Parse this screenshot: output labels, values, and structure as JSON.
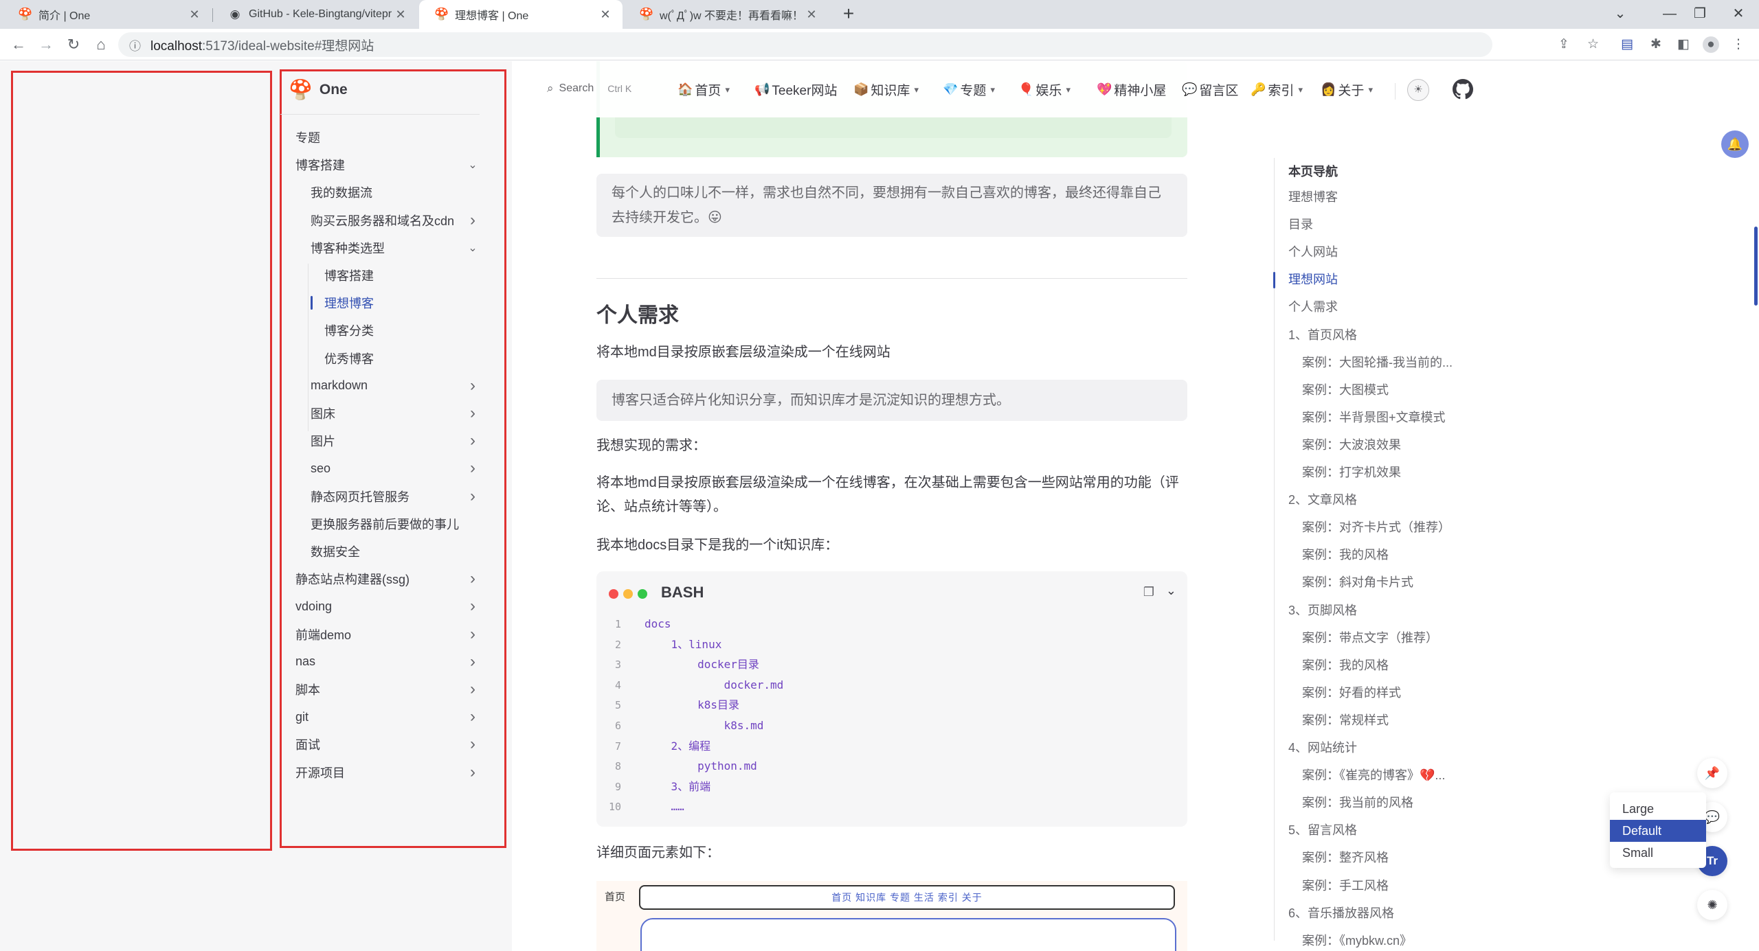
{
  "browser": {
    "tabs": [
      {
        "title": "简介 | One",
        "favicon": "vitepress-logo"
      },
      {
        "title": "GitHub - Kele-Bingtang/vitepr",
        "favicon": "github-icon"
      },
      {
        "title": "理想博客 | One",
        "favicon": "vitepress-logo"
      },
      {
        "title": "w(ﾟДﾟ)w 不要走！再看看嘛！",
        "favicon": "vitepress-logo"
      }
    ],
    "url_host": "localhost",
    "url_rest": ":5173/ideal-website#理想网站"
  },
  "sidebar": {
    "brand": "One",
    "items": [
      {
        "label": "专题",
        "level": 0,
        "chevron": ""
      },
      {
        "label": "博客搭建",
        "level": 0,
        "chevron": "down"
      },
      {
        "label": "我的数据流",
        "level": 1,
        "chevron": ""
      },
      {
        "label": "购买云服务器和域名及cdn",
        "level": 1,
        "chevron": "right"
      },
      {
        "label": "博客种类选型",
        "level": 1,
        "chevron": "down"
      },
      {
        "label": "博客搭建",
        "level": 2,
        "chevron": ""
      },
      {
        "label": "理想博客",
        "level": 2,
        "chevron": "",
        "active": true
      },
      {
        "label": "博客分类",
        "level": 2,
        "chevron": ""
      },
      {
        "label": "优秀博客",
        "level": 2,
        "chevron": ""
      },
      {
        "label": "markdown",
        "level": 1,
        "chevron": "right"
      },
      {
        "label": "图床",
        "level": 1,
        "chevron": "right"
      },
      {
        "label": "图片",
        "level": 1,
        "chevron": "right"
      },
      {
        "label": "seo",
        "level": 1,
        "chevron": "right"
      },
      {
        "label": "静态网页托管服务",
        "level": 1,
        "chevron": "right"
      },
      {
        "label": "更换服务器前后要做的事儿",
        "level": 1,
        "chevron": ""
      },
      {
        "label": "数据安全",
        "level": 1,
        "chevron": ""
      },
      {
        "label": "静态站点构建器(ssg)",
        "level": 0,
        "chevron": "right"
      },
      {
        "label": "vdoing",
        "level": 0,
        "chevron": "right"
      },
      {
        "label": "前端demo",
        "level": 0,
        "chevron": "right"
      },
      {
        "label": "nas",
        "level": 0,
        "chevron": "right"
      },
      {
        "label": "脚本",
        "level": 0,
        "chevron": "right"
      },
      {
        "label": "git",
        "level": 0,
        "chevron": "right"
      },
      {
        "label": "面试",
        "level": 0,
        "chevron": "right"
      },
      {
        "label": "开源项目",
        "level": 0,
        "chevron": "right"
      }
    ]
  },
  "topnav": {
    "search_label": "Search",
    "search_kbd": "Ctrl K",
    "items": [
      {
        "label": "首页",
        "icon": "🏠",
        "dropdown": true
      },
      {
        "label": "Teeker网站",
        "icon": "📢",
        "dropdown": false
      },
      {
        "label": "知识库",
        "icon": "📦",
        "dropdown": true
      },
      {
        "label": "专题",
        "icon": "💎",
        "dropdown": true
      },
      {
        "label": "娱乐",
        "icon": "🎈",
        "dropdown": true
      },
      {
        "label": "精神小屋",
        "icon": "💖",
        "dropdown": false
      },
      {
        "label": "留言区",
        "icon": "💬",
        "dropdown": false
      },
      {
        "label": "索引",
        "icon": "🔑",
        "dropdown": true
      },
      {
        "label": "关于",
        "icon": "👩",
        "dropdown": true
      }
    ]
  },
  "content": {
    "quote1_line1": "每个人的口味儿不一样，需求也自然不同，要想拥有一款自己喜欢的博客，最终还得靠自己",
    "quote1_line2": "去持续开发它。😛",
    "h2": "个人需求",
    "p1": "将本地md目录按原嵌套层级渲染成一个在线网站",
    "quote2": "博客只适合碎片化知识分享，而知识库才是沉淀知识的理想方式。",
    "p2": "我想实现的需求：",
    "p3_line1": "将本地md目录按原嵌套层级渲染成一个在线博客，在次基础上需要包含一些网站常用的功能（评",
    "p3_line2": "论、站点统计等等）。",
    "p4": "我本地docs目录下是我的一个it知识库：",
    "code_lang": "BASH",
    "code_lines": [
      "docs",
      "    1、linux",
      "        docker目录",
      "            docker.md",
      "        k8s目录",
      "            k8s.md",
      "    2、编程",
      "        python.md",
      "    3、前端",
      "    ……"
    ],
    "p5": "详细页面元素如下：",
    "demo_label": "首页",
    "demo_bar": "首页 知识库 专题 生活 索引 关于"
  },
  "outline": {
    "title": "本页导航",
    "items": [
      {
        "label": "理想博客",
        "level": 0
      },
      {
        "label": "目录",
        "level": 0
      },
      {
        "label": "个人网站",
        "level": 0
      },
      {
        "label": "理想网站",
        "level": 0,
        "active": true
      },
      {
        "label": "个人需求",
        "level": 0
      },
      {
        "label": "1、首页风格",
        "level": 0
      },
      {
        "label": "案例：大图轮播-我当前的...",
        "level": 1
      },
      {
        "label": "案例：大图模式",
        "level": 1
      },
      {
        "label": "案例：半背景图+文章模式",
        "level": 1
      },
      {
        "label": "案例：大波浪效果",
        "level": 1
      },
      {
        "label": "案例：打字机效果",
        "level": 1
      },
      {
        "label": "2、文章风格",
        "level": 0
      },
      {
        "label": "案例：对齐卡片式（推荐）",
        "level": 1
      },
      {
        "label": "案例：我的风格",
        "level": 1
      },
      {
        "label": "案例：斜对角卡片式",
        "level": 1
      },
      {
        "label": "3、页脚风格",
        "level": 0
      },
      {
        "label": "案例：带点文字（推荐）",
        "level": 1
      },
      {
        "label": "案例：我的风格",
        "level": 1
      },
      {
        "label": "案例：好看的样式",
        "level": 1
      },
      {
        "label": "案例：常规样式",
        "level": 1
      },
      {
        "label": "4、网站统计",
        "level": 0
      },
      {
        "label": "案例：《崔亮的博客》💔...",
        "level": 1
      },
      {
        "label": "案例：我当前的风格",
        "level": 1
      },
      {
        "label": "5、留言风格",
        "level": 0
      },
      {
        "label": "案例：整齐风格",
        "level": 1
      },
      {
        "label": "案例：手工风格",
        "level": 1
      },
      {
        "label": "6、音乐播放器风格",
        "level": 0
      },
      {
        "label": "案例：《mybkw.cn》",
        "level": 1
      }
    ]
  },
  "font_size_menu": {
    "options": [
      "Large",
      "Default",
      "Small"
    ],
    "selected": "Default"
  },
  "fab_text": "Tr",
  "colors": {
    "brand": "#3451b2",
    "highlight_box": "#e03131",
    "tip_green": "#18a058"
  }
}
